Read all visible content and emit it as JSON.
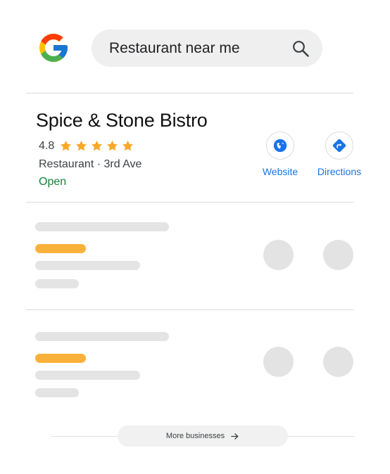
{
  "search": {
    "query": "Restaurant near me",
    "icon": "search-icon"
  },
  "logo": {
    "name": "google-logo-icon",
    "colors": {
      "blue": "#4285F4",
      "red": "#EA4335",
      "yellow": "#FBBC05",
      "green": "#34A853"
    }
  },
  "result": {
    "title": "Spice & Stone Bistro",
    "rating": "4.8",
    "stars": 5,
    "subtitle": "Restaurant · 3rd Ave",
    "status": "Open",
    "status_color": "#188038",
    "star_color": "#F9A825",
    "actions": [
      {
        "label": "Website",
        "icon": "globe-icon"
      },
      {
        "label": "Directions",
        "icon": "directions-icon"
      }
    ]
  },
  "footer": {
    "more_label": "More businesses",
    "icon": "arrow-right-icon"
  }
}
